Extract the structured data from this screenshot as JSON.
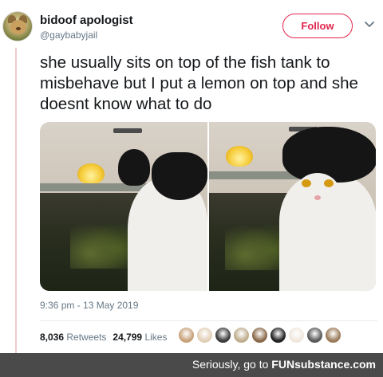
{
  "tweet": {
    "display_name": "bidoof apologist",
    "handle": "@gaybabyjail",
    "follow_label": "Follow",
    "chevron_icon": "chevron-down-icon",
    "text": "she usually sits on top of the fish tank  to misbehave but I put a lemon on top and she doesnt know what to do",
    "timestamp": "9:36 pm - 13 May 2019",
    "retweets_count": "8,036",
    "retweets_label": "Retweets",
    "likes_count": "24,799",
    "likes_label": "Likes"
  },
  "likers": [
    {
      "name": "liker-avatar",
      "color": "#c9a27a"
    },
    {
      "name": "liker-avatar",
      "color": "#e2cfb8"
    },
    {
      "name": "liker-avatar",
      "color": "#3b3b3b"
    },
    {
      "name": "liker-avatar",
      "color": "#bfae8e"
    },
    {
      "name": "liker-avatar",
      "color": "#8a6a4a"
    },
    {
      "name": "liker-avatar",
      "color": "#222222"
    },
    {
      "name": "liker-avatar",
      "color": "#efe7dd"
    },
    {
      "name": "liker-avatar",
      "color": "#5a5a5a"
    },
    {
      "name": "liker-avatar",
      "color": "#9a7b5a"
    }
  ],
  "colors": {
    "follow_accent": "#e2264d",
    "secondary_text": "#657786",
    "watermark_bg": "#4a4a4a"
  },
  "watermark": {
    "prefix": "Seriously, go to ",
    "brand_bold": "FUN",
    "brand_rest": "substance.com"
  }
}
